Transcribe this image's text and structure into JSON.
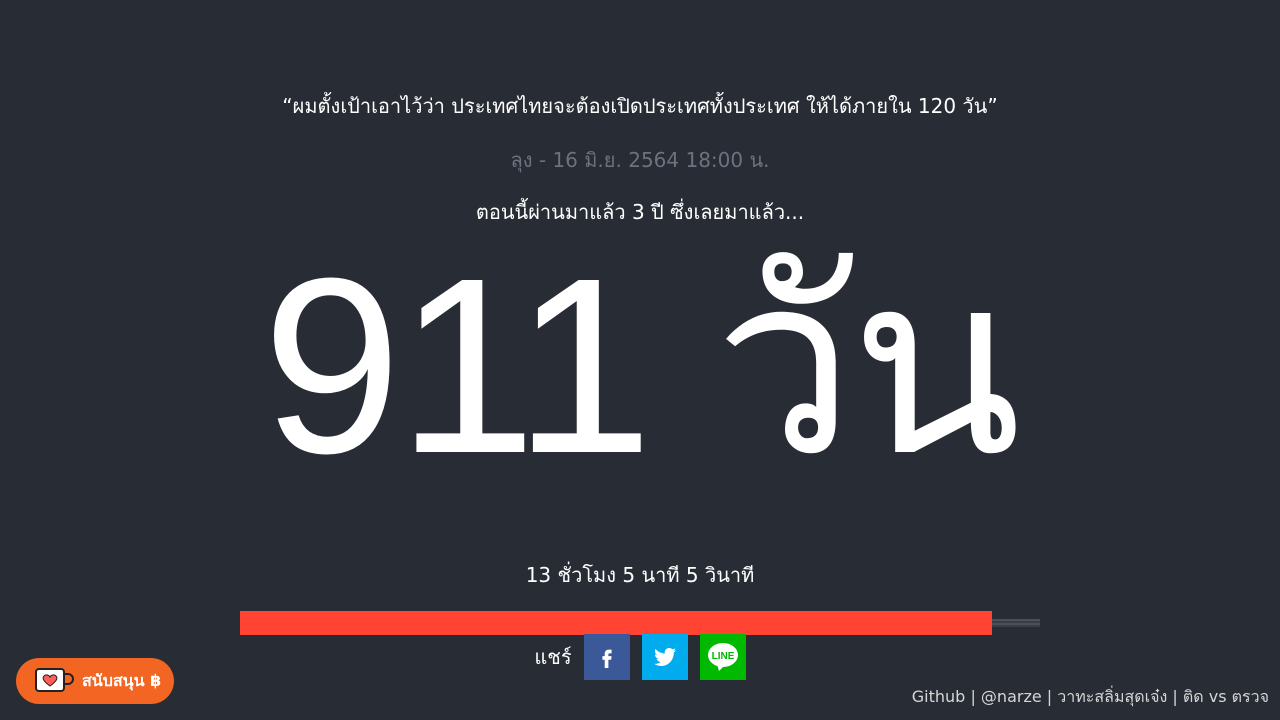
{
  "quote": "“ผมตั้งเป้าเอาไว้ว่า ประเทศไทยจะต้องเปิดประเทศทั้งประเทศ ให้ได้ภายใน 120 วัน”",
  "attribution": "ลุง - 16 มิ.ย. 2564 18:00 น.",
  "elapsed_text": "ตอนนี้ผ่านมาแล้ว 3 ปี ซึ่งเลยมาแล้ว...",
  "big_days": "911 วัน",
  "remainder": "13 ชั่วโมง 5 นาที 5 วินาที",
  "progress": {
    "fraction": 0.94,
    "fill_color": "#ff4433"
  },
  "share": {
    "label": "แชร์",
    "buttons": [
      {
        "name": "facebook",
        "icon": "facebook-icon",
        "color": "#3b5998"
      },
      {
        "name": "twitter",
        "icon": "twitter-icon",
        "color": "#00aced"
      },
      {
        "name": "line",
        "icon": "line-icon",
        "color": "#00b900"
      }
    ]
  },
  "support": {
    "label": "สนับสนุน ฿",
    "icon": "coffee-cup-heart-icon",
    "color": "#f26522"
  },
  "footer": {
    "links": [
      "Github",
      "@narze",
      "วาทะสลิ่มสุดเจ๋ง",
      "ติด vs ตรวจ"
    ],
    "separator": "|"
  },
  "colors": {
    "background": "#282c34",
    "muted_text": "#6b7280"
  }
}
